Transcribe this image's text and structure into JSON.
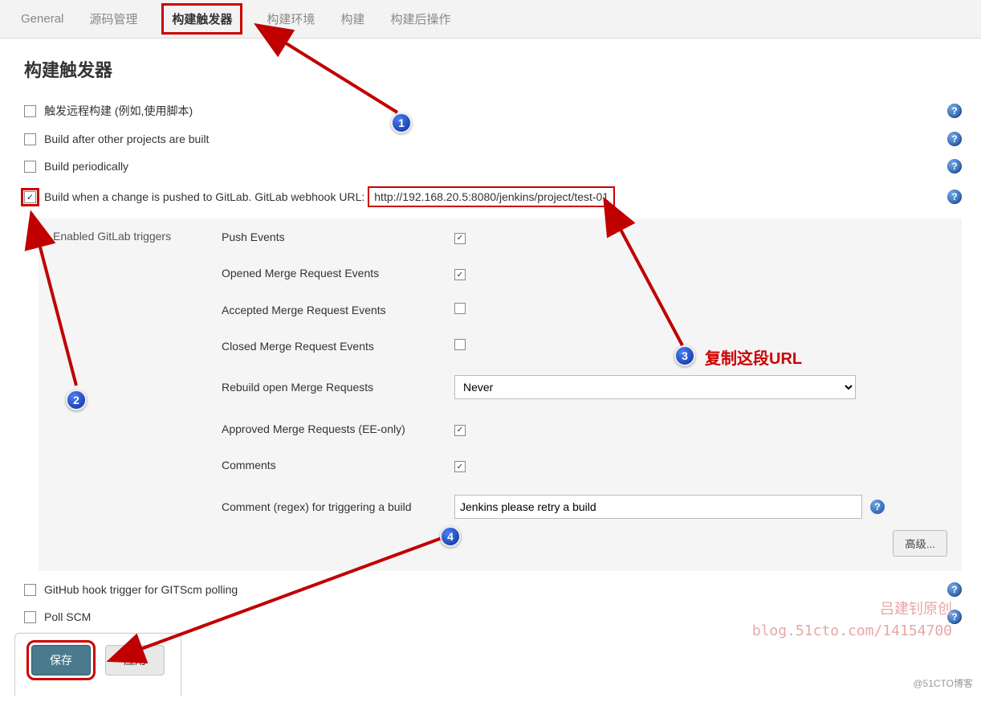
{
  "tabs": {
    "general": "General",
    "scm": "源码管理",
    "triggers": "构建触发器",
    "env": "构建环境",
    "build": "构建",
    "post": "构建后操作"
  },
  "section_title": "构建触发器",
  "options": {
    "remote": "触发远程构建 (例如,使用脚本)",
    "after": "Build after other projects are built",
    "periodic": "Build periodically",
    "gitlab_prefix": "Build when a change is pushed to GitLab. GitLab webhook URL:",
    "gitlab_url": "http://192.168.20.5:8080/jenkins/project/test-01",
    "github": "GitHub hook trigger for GITScm polling",
    "pollscm": "Poll SCM"
  },
  "gitlab": {
    "header": "Enabled GitLab triggers",
    "push": "Push Events",
    "opened_mr": "Opened Merge Request Events",
    "accepted_mr": "Accepted Merge Request Events",
    "closed_mr": "Closed Merge Request Events",
    "rebuild_open": "Rebuild open Merge Requests",
    "rebuild_value": "Never",
    "approved": "Approved Merge Requests (EE-only)",
    "comments": "Comments",
    "comment_regex_label": "Comment (regex) for triggering a build",
    "comment_regex_value": "Jenkins please retry a build",
    "advanced": "高级..."
  },
  "buttons": {
    "save": "保存",
    "apply": "应用"
  },
  "annotations": {
    "copy_url": "复制这段URL"
  },
  "watermark": {
    "line1": "吕建钊原创",
    "line2": "blog.51cto.com/14154700",
    "corner": "@51CTO博客"
  },
  "help_glyph": "?"
}
